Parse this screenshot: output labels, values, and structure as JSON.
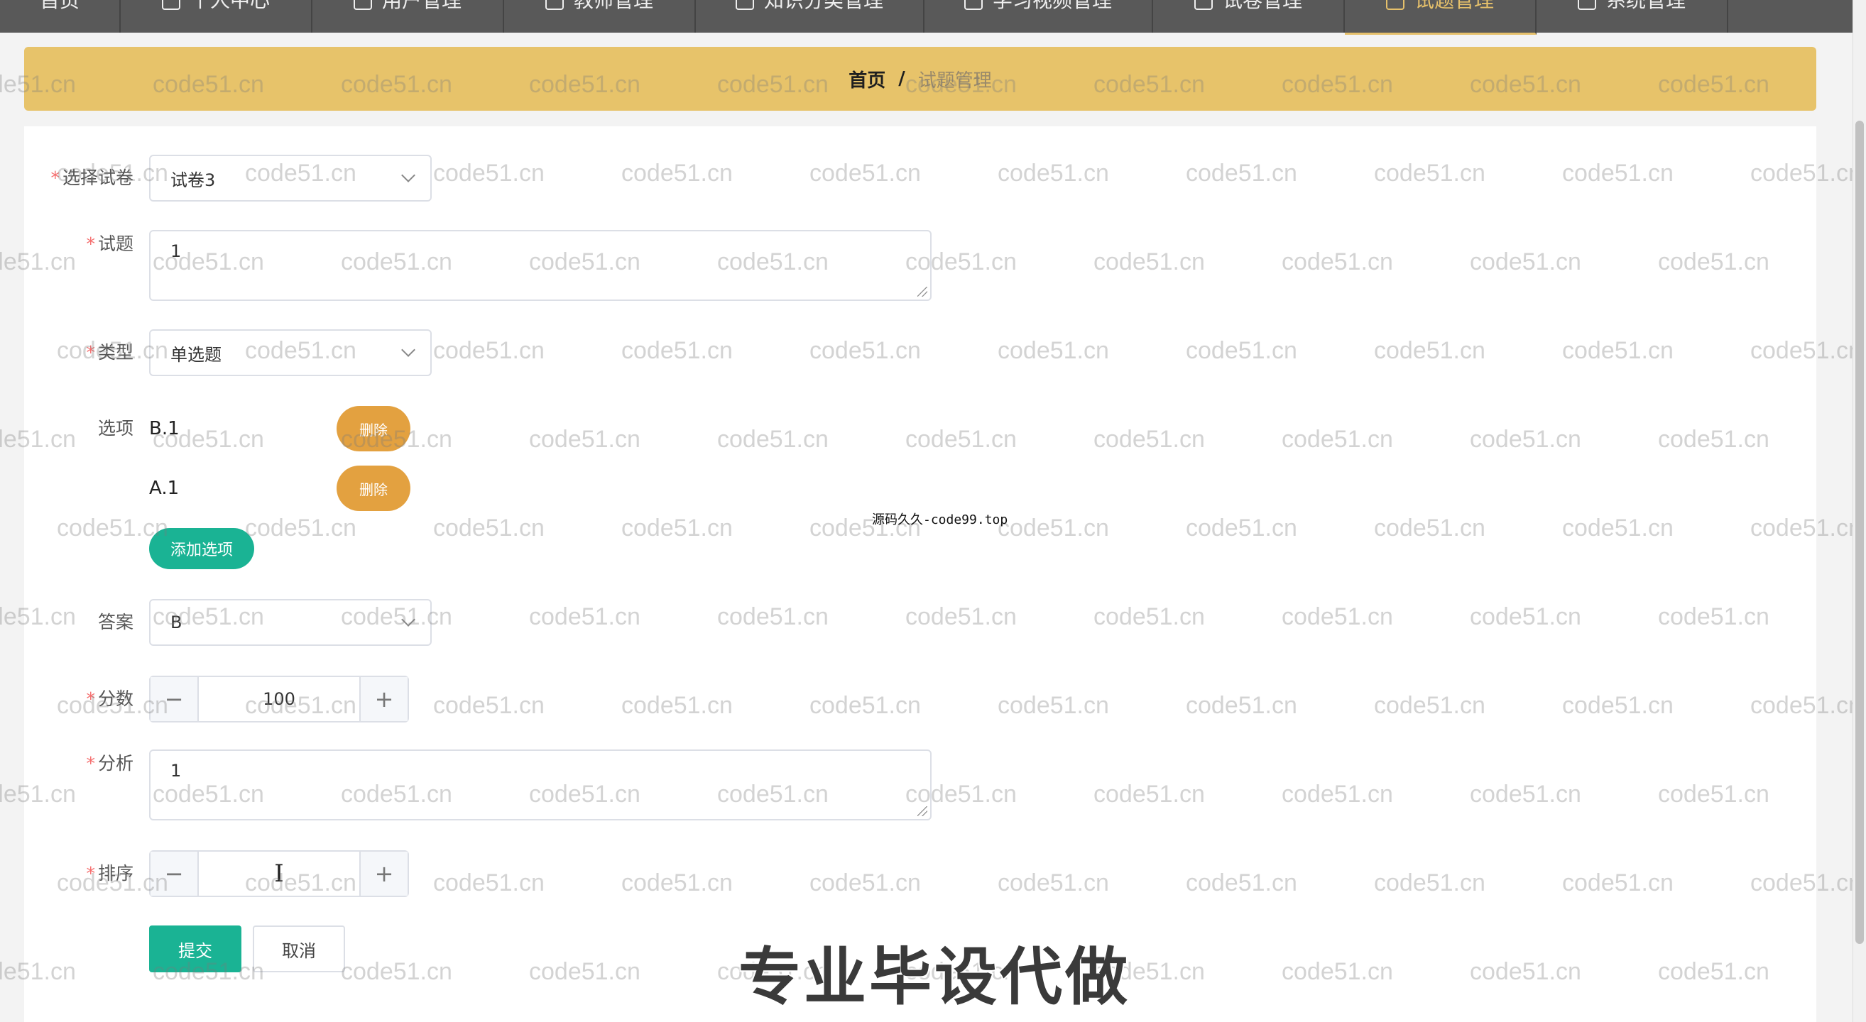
{
  "nav": {
    "items": [
      {
        "label": "首页",
        "active": false
      },
      {
        "label": "个人中心",
        "active": false
      },
      {
        "label": "用户管理",
        "active": false
      },
      {
        "label": "教师管理",
        "active": false
      },
      {
        "label": "知识分类管理",
        "active": false
      },
      {
        "label": "学习视频管理",
        "active": false
      },
      {
        "label": "试卷管理",
        "active": false
      },
      {
        "label": "试题管理",
        "active": true
      },
      {
        "label": "系统管理",
        "active": false
      }
    ]
  },
  "breadcrumb": {
    "home": "首页",
    "separator": "/",
    "current": "试题管理"
  },
  "form": {
    "paper": {
      "label": "选择试卷",
      "value": "试卷3"
    },
    "question": {
      "label": "试题",
      "value": "1"
    },
    "type": {
      "label": "类型",
      "value": "单选题"
    },
    "options": {
      "label": "选项",
      "items": [
        {
          "text": "B.1",
          "delete_label": "删除"
        },
        {
          "text": "A.1",
          "delete_label": "删除"
        }
      ],
      "add_label": "添加选项"
    },
    "answer": {
      "label": "答案",
      "value": "B"
    },
    "score": {
      "label": "分数",
      "value": "100",
      "minus": "−",
      "plus": "+"
    },
    "analysis": {
      "label": "分析",
      "value": "1"
    },
    "sort": {
      "label": "排序",
      "value": "",
      "minus": "−",
      "plus": "+",
      "cursor": "I"
    },
    "submit_label": "提交",
    "cancel_label": "取消",
    "required_mark": "*"
  },
  "watermark": {
    "text": "code51.cn"
  },
  "center_note": "源码久久-code99.top",
  "overlay_caption": "专业毕设代做",
  "colors": {
    "nav_bg": "#595959",
    "active_nav": "#e5c06b",
    "breadcrumb_bg": "#e7c36a",
    "primary": "#1ab394",
    "delete": "#e3a140",
    "required": "#f56c6c"
  }
}
